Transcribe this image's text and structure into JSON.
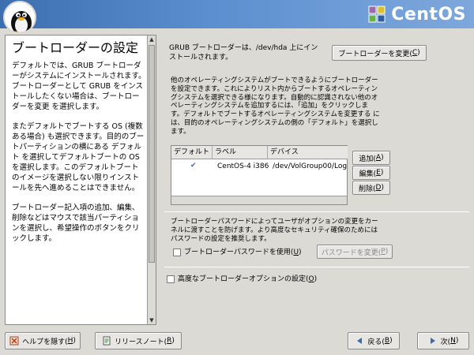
{
  "banner": {
    "brand": "CentOS",
    "colors": {
      "accent": "#3c6fb0",
      "purple": "#9c6ba8",
      "yellow": "#e0c020",
      "green": "#6ab04c"
    }
  },
  "help": {
    "title": "ブートローダーの設定",
    "paragraphs": [
      "デフォルトでは、GRUB ブートローダーがシステムにインストールされます。ブートローダーとして GRUB をインストールしたくない場合は、ブートローダーを変更 を選択します。",
      "またデフォルトでブートする OS (複数ある場合) も選択できます。目的のブートパーティションの横にある デフォルト を選択してデフォルトブートの OS を選択します。このデフォルトブートのイメージを選択しない限りインストールを先へ進めることはできません。",
      "ブートローダー記入項の追加、編集、削除などはマウスで該当パーティションを選択し、希望操作のボタンをクリックします。"
    ]
  },
  "grub": {
    "info": "GRUB ブートローダーは、/dev/hda 上にインストールされます。",
    "change_button": "ブートローダーを変更(C)",
    "change_button_pre": "ブートローダーを変更(",
    "change_button_key": "C",
    "change_button_post": ")"
  },
  "other_os": {
    "text": "他のオペレーティングシステムがブートできるようにブートローダーを設定できます。これによりリスト内からブートするオペレーティングシステムを選択できる様になります。自動的に認識されない他のオペレーティングシステムを追加するには、「追加」をクリックします。デフォルトでブートするオペレーティングシステムを変更する には、目的のオペレーティングシステムの側の「デフォルト」を選択します。"
  },
  "table": {
    "headers": [
      "デフォルト",
      "ラベル",
      "デバイス"
    ],
    "rows": [
      {
        "default": "✔",
        "label": "CentOS-4 i386",
        "device": "/dev/VolGroup00/LogV"
      }
    ]
  },
  "side_buttons": {
    "add": {
      "pre": "追加(",
      "key": "A",
      "post": ")"
    },
    "edit": {
      "pre": "編集(",
      "key": "E",
      "post": ")"
    },
    "delete": {
      "pre": "削除(",
      "key": "D",
      "post": ")"
    }
  },
  "password": {
    "text": "ブートローダーパスワードによってユーザがオプションの変更をカーネルに渡すことを防げます。より高度なセキュリティ確保のためにはパスワードの設定を推奨します。",
    "checkbox": {
      "pre": "ブートローダーパスワードを使用(",
      "key": "U",
      "post": ")"
    },
    "change_button": {
      "pre": "パスワードを変更(",
      "key": "P",
      "post": ")"
    }
  },
  "advanced": {
    "pre": "高度なブートローダーオプションの設定(",
    "key": "O",
    "post": ")"
  },
  "footer": {
    "hide_help": {
      "pre": "ヘルプを隠す(",
      "key": "H",
      "post": ")"
    },
    "release_notes": {
      "pre": "リリースノート(",
      "key": "R",
      "post": ")"
    },
    "back": {
      "pre": "戻る(",
      "key": "B",
      "post": ")"
    },
    "next": {
      "pre": "次(",
      "key": "N",
      "post": ")"
    }
  }
}
